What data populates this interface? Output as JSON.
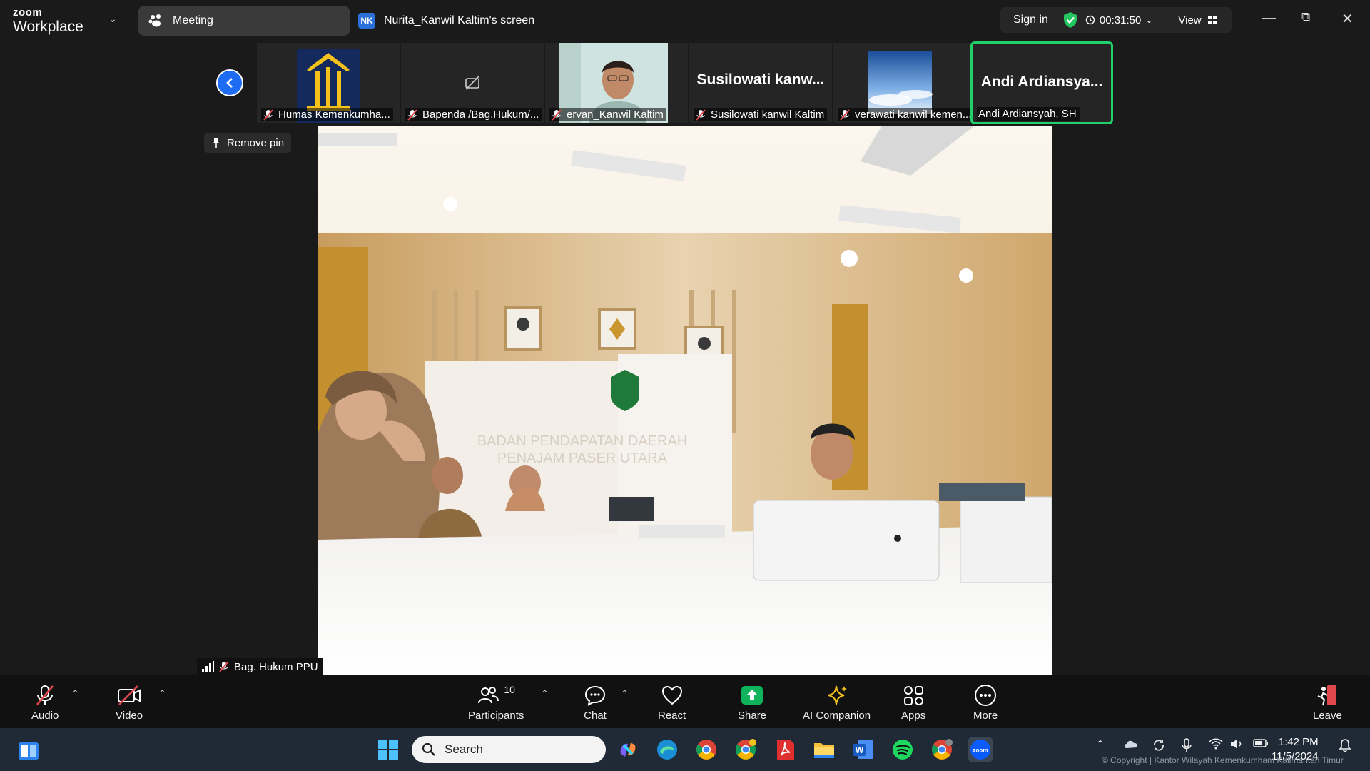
{
  "titlebar": {
    "logo_small": "zoom",
    "logo_big": "Workplace",
    "meeting_tab": "Meeting",
    "screen_tab_initials": "NK",
    "screen_tab_label": "Nurita_Kanwil Kaltim's screen",
    "sign_in": "Sign in",
    "timer": "00:31:50",
    "view": "View"
  },
  "participants_strip": [
    {
      "label": "Humas Kemenkumha...",
      "display": "logo"
    },
    {
      "label": "Bapenda /Bag.Hukum/...",
      "display": "video-off"
    },
    {
      "label": "ervan_Kanwil Kaltim",
      "display": "video"
    },
    {
      "label": "Susilowati kanwil Kaltim",
      "display": "name",
      "big_name": "Susilowati  kanw..."
    },
    {
      "label": "verawati kanwil kemen...",
      "display": "image"
    },
    {
      "label": "Andi Ardiansyah, SH",
      "display": "name",
      "big_name": "Andi  Ardiansya...",
      "active": true
    }
  ],
  "remove_pin": "Remove pin",
  "main_video": {
    "name_tag": "Bag. Hukum PPU",
    "banner_line1": "BADAN PENDAPATAN DAERAH",
    "banner_line2": "PENAJAM PASER UTARA"
  },
  "toolbar": {
    "audio": "Audio",
    "video": "Video",
    "participants": "Participants",
    "participants_count": "10",
    "chat": "Chat",
    "react": "React",
    "share": "Share",
    "ai_companion": "AI Companion",
    "apps": "Apps",
    "more": "More",
    "leave": "Leave"
  },
  "taskbar": {
    "search_placeholder": "Search",
    "time": "1:42 PM",
    "date": "11/5/2024",
    "copyright": "© Copyright | Kantor Wilayah Kemenkumham Kalimantan Timur"
  },
  "colors": {
    "accent_blue": "#1e6cf2",
    "active_speaker": "#22d06b",
    "share_green": "#0fb35b",
    "muted_red": "#e0484d"
  }
}
